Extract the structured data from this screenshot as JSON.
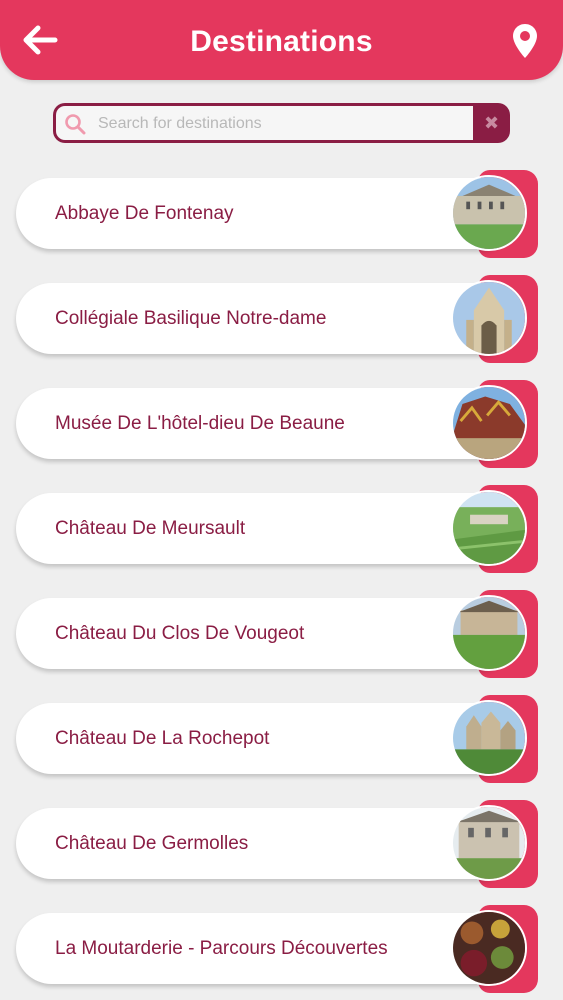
{
  "header": {
    "title": "Destinations",
    "back_icon": "arrow-left-icon",
    "location_icon": "map-pin-icon",
    "color": "#e4375d"
  },
  "search": {
    "placeholder": "Search for destinations",
    "value": "",
    "clear_label": "✖",
    "icon": "search-icon"
  },
  "destinations": [
    {
      "name": "Abbaye De Fontenay"
    },
    {
      "name": "Collégiale Basilique Notre-dame"
    },
    {
      "name": "Musée De L'hôtel-dieu De Beaune"
    },
    {
      "name": "Château De Meursault"
    },
    {
      "name": "Château Du Clos De Vougeot"
    },
    {
      "name": "Château De La Rochepot"
    },
    {
      "name": "Château De Germolles"
    },
    {
      "name": "La Moutarderie - Parcours Découvertes"
    }
  ],
  "colors": {
    "accent": "#e4375d",
    "text": "#8a1d44",
    "background": "#efefef"
  }
}
